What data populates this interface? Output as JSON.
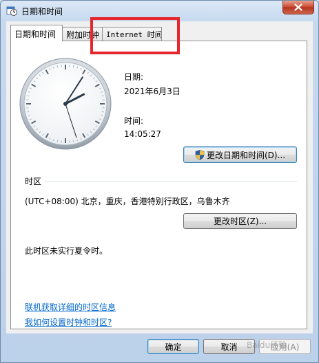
{
  "window": {
    "title": "日期和时间"
  },
  "tabs": [
    {
      "label": "日期和时间"
    },
    {
      "label": "附加时钟"
    },
    {
      "label": "Internet 时间"
    }
  ],
  "date": {
    "label": "日期:",
    "value": "2021年6月3日"
  },
  "time": {
    "label": "时间:",
    "value": "14:05:27"
  },
  "buttons": {
    "change_datetime": "更改日期和时间(D)...",
    "change_timezone": "更改时区(Z)...",
    "ok": "确定",
    "cancel": "取消",
    "apply": "应用(A)"
  },
  "timezone": {
    "section_label": "时区",
    "value": "(UTC+08:00) 北京，重庆，香港特别行政区，乌鲁木齐",
    "dst_note": "此时区未实行夏令时。"
  },
  "links": {
    "online_info": "联机获取详细的时区信息",
    "how_to_set": "我如何设置时钟和时区?"
  },
  "clock": {
    "hours": 14,
    "minutes": 5,
    "seconds": 27
  },
  "colors": {
    "highlight": "#e5262c",
    "link": "#0066cc"
  },
  "watermark": "Baidu经验"
}
